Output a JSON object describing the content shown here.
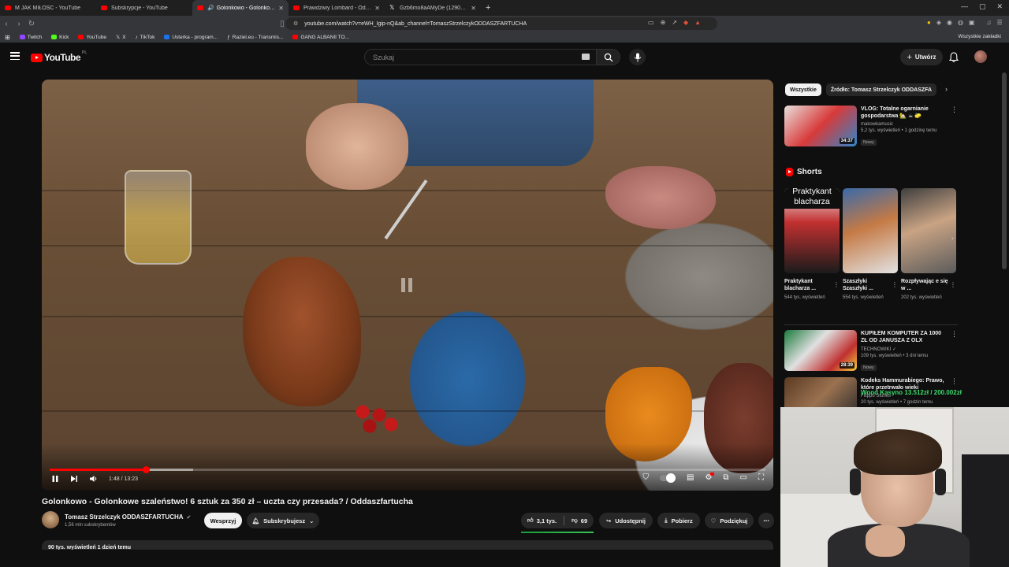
{
  "browser": {
    "tabs": [
      {
        "title": "M JAK MIŁOŚĆ - YouTube",
        "icon": "youtube-favicon",
        "active": false
      },
      {
        "title": "Subskrypcje - YouTube",
        "icon": "youtube-favicon",
        "active": false
      },
      {
        "title": "Golonkowo - Golonkowe sza...",
        "icon": "youtube-favicon",
        "active": true
      },
      {
        "title": "Prawdziwy Lombard - Odcinek 282",
        "icon": "youtube-favicon",
        "active": false
      },
      {
        "title": "Gzb6mo8aAMyDe (1290×1686)",
        "icon": "x-favicon",
        "active": false
      }
    ],
    "url": "youtube.com/watch?v=eWH_Igip-nQ&ab_channel=TomaszStrzelczykODDASZFARTUCHA",
    "bookmarks": [
      {
        "label": "Twitch",
        "color": "#9146ff"
      },
      {
        "label": "Kick",
        "color": "#53fc18"
      },
      {
        "label": "YouTube",
        "color": "#ff0000"
      },
      {
        "label": "X",
        "color": "#ffffff"
      },
      {
        "label": "TikTok",
        "color": "#ffffff"
      },
      {
        "label": "Usterka - program...",
        "color": "#1a73e8"
      },
      {
        "label": "Raziel.eu - Transmis...",
        "color": "#bbbbbb"
      },
      {
        "label": "GANG ALBANII TO...",
        "color": "#ff0000"
      }
    ],
    "bookmarks_right": "Wszystkie zakładki"
  },
  "masthead": {
    "logo_word": "YouTube",
    "country_code": "PL",
    "search_placeholder": "Szukaj",
    "create_label": "Utwórz"
  },
  "player": {
    "current_time": "1:48",
    "duration": "13:23",
    "time_display": "1:48 / 13:23",
    "played_fraction": 0.1345,
    "loaded_fraction": 0.2
  },
  "video": {
    "title": "Golonkowo - Golonkowe szaleństwo! 6 sztuk za 350 zł – uczta czy przesada? / Oddaszfartucha",
    "channel": "Tomasz Strzelczyk ODDASZFARTUCHA",
    "subscribers": "1,56 mln subskrybentów",
    "support_label": "Wesprzyj",
    "subscribe_label": "Subskrybujesz",
    "likes": "3,1 tys.",
    "dislikes": "69",
    "share_label": "Udostępnij",
    "download_label": "Pobierz",
    "thanks_label": "Podziękuj",
    "description_preview": "90 tys. wyświetleń  1 dzień temu"
  },
  "sidebar": {
    "chips": [
      "Wszystkie",
      "Źródło: Tomasz Strzelczyk ODDASZFA"
    ],
    "recommendations_top": [
      {
        "title": "VLOG: Totalne ogarnianie gospodarstwa 🏡 ☕ 🧽",
        "channel": "makowkamusic",
        "meta": "5,2 tys. wyświetleń • 1 godzinę temu",
        "badge": "Nowy",
        "duration": "34:37"
      }
    ],
    "shorts_heading": "Shorts",
    "shorts": [
      {
        "title": "Praktykant blacharza ...",
        "views": "544 tys. wyświetleń",
        "overlay": "Praktykant blacharza"
      },
      {
        "title": "Szaszłyki Szaszłyki ...",
        "views": "554 tys. wyświetleń"
      },
      {
        "title": "Rozpływając e się w ...",
        "views": "202 tys. wyświetleń"
      }
    ],
    "recommendations_bottom": [
      {
        "title": "KUPIŁEM KOMPUTER ZA 1000 ZŁ OD JANUSZA Z OLX",
        "channel": "TECHNOWIKI ✓",
        "meta": "109 tys. wyświetleń • 3 dni temu",
        "badge": "Nowy",
        "duration": "28:39"
      },
      {
        "title": "Kodeks Hammurabiego: Prawo, które przetrwało wieki",
        "channel": "Filippo Stories",
        "meta": "20 tys. wyświetleń • 7 godzin temu",
        "duration": ""
      }
    ]
  },
  "stream_overlay": "Wood Kasyno 13.512zł / 200.002zł"
}
